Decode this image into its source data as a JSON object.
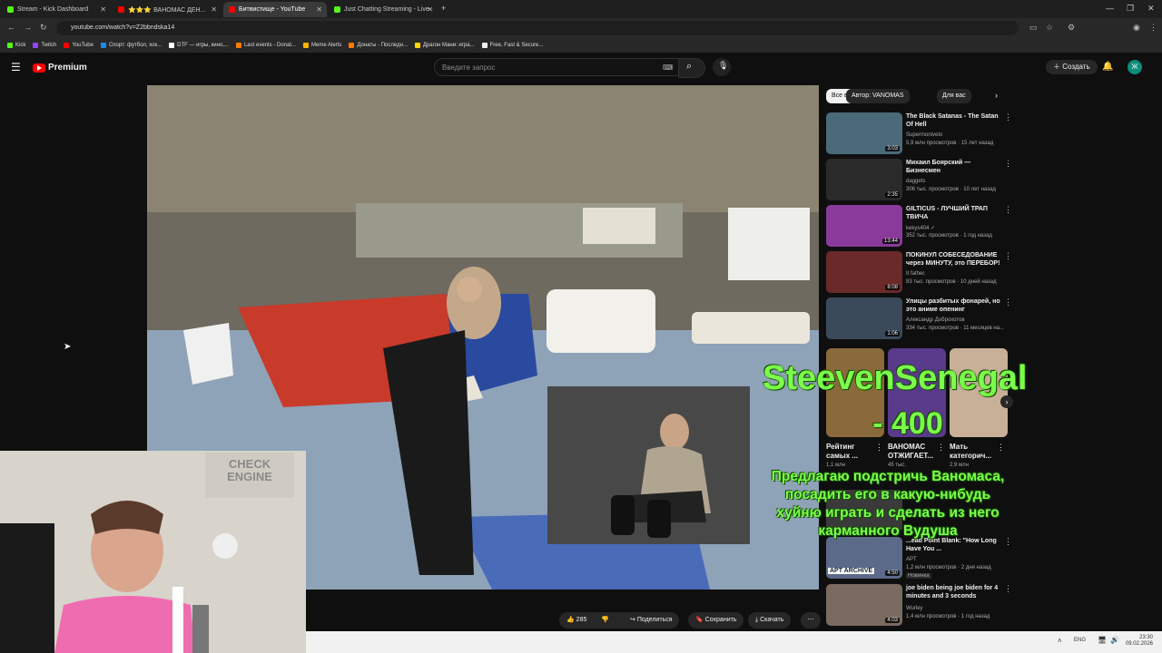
{
  "browser": {
    "tabs": [
      {
        "title": "Stream - Kick Dashboard",
        "color": "#53fc18"
      },
      {
        "title": "⭐⭐⭐ ВАНОМАС ДЕН...",
        "color": "#ff0000"
      },
      {
        "title": "Битвистище - YouTube",
        "color": "#ff0000"
      },
      {
        "title": "Just Chatting Streaming - Live ·",
        "color": "#53fc18"
      }
    ],
    "url": "youtube.com/watch?v=Z2bbndska14",
    "bookmarks": [
      "Kick",
      "Twitch",
      "YouTube",
      "Спорт: футбол, хок...",
      "DTF — игры, кино,...",
      "Last events - Donat...",
      "Meme Alerts",
      "Донаты - Последн...",
      "Драгон Мани: игра...",
      "Free, Fast & Secure..."
    ]
  },
  "youtube": {
    "logo": "Premium",
    "search_placeholder": "Введите запрос",
    "create_label": "Создать",
    "avatar_letter": "Ж"
  },
  "actions": {
    "likes": "285",
    "share": "Поделиться",
    "save": "Сохранить",
    "download": "Скачать"
  },
  "sidebar": {
    "chips": [
      "Все видео",
      "Автор: VANOMAS",
      "Для вас"
    ],
    "recommendations": [
      {
        "title": "The Black Satanas - The Satan Of Hell",
        "channel": "Supermoniveto",
        "meta": "5,9 млн просмотров · 15 лет назад",
        "duration": "3:03",
        "thumb": "#4a6a7a"
      },
      {
        "title": "Михаил Боярский — Бизнесмен",
        "channel": "daggets",
        "meta": "306 тыс. просмотров · 10 лет назад",
        "duration": "2:35",
        "thumb": "#2a2a2a"
      },
      {
        "title": "GILTICUS - ЛУЧШИЙ ТРАП ТВИЧА",
        "channel": "kekys404 ✓",
        "meta": "352 тыс. просмотров · 1 год назад",
        "duration": "13:44",
        "thumb": "#8a3a9a"
      },
      {
        "title": "ПОКИНУЛ СОБЕСЕДОВАНИЕ через МИНУТУ, это ПЕРЕБОР!",
        "channel": "It father.",
        "meta": "83 тыс. просмотров · 10 дней назад",
        "duration": "8:08",
        "thumb": "#6a2a2a"
      },
      {
        "title": "Улицы разбитых фонарей, но это аниме опенинг",
        "channel": "Александр Доброхотов",
        "meta": "334 тыс. просмотров · 11 месяцев на...",
        "duration": "1:06",
        "thumb": "#3a4a5a"
      }
    ],
    "shorts": [
      {
        "title": "Рейтинг самых ...",
        "meta": "1,1 млн",
        "color": "#8a6a3a"
      },
      {
        "title": "ВАНОМАС ОТЖИГАЕТ...",
        "meta": "45 тыс.",
        "color": "#5a3a8a"
      },
      {
        "title": "Мать категорич...",
        "meta": "2,9 млн",
        "color": "#c8b098"
      }
    ],
    "lower": [
      {
        "title": "...ead Point Blank: \"How Long Have You ...",
        "channel": "APT",
        "meta": "1,2 млн просмотров · 2 дня назад",
        "badge": "Новинка",
        "duration": "4:50",
        "thumb_label": "APT ARCHIVE"
      },
      {
        "title": "joe biden being joe biden for 4 minutes and 3 seconds",
        "channel": "Wurley",
        "meta": "1,4 млн просмотров · 1 год назад",
        "duration": "4:03"
      }
    ]
  },
  "overlay": {
    "donor": "SteevenSenegal",
    "amount": "- 400",
    "message": "Предлагаю подстричь Ваномаса, посадить его в какую-нибудь хуйню играть и сделать из него карманного Вудуша"
  },
  "facecam": {
    "sign": "CHECK ENGINE"
  },
  "taskbar": {
    "lang": "ENG",
    "time": "23:30",
    "date": "09.02.2026"
  },
  "colors": {
    "yt_red": "#ff0000",
    "overlay_green": "#7cff4a"
  }
}
